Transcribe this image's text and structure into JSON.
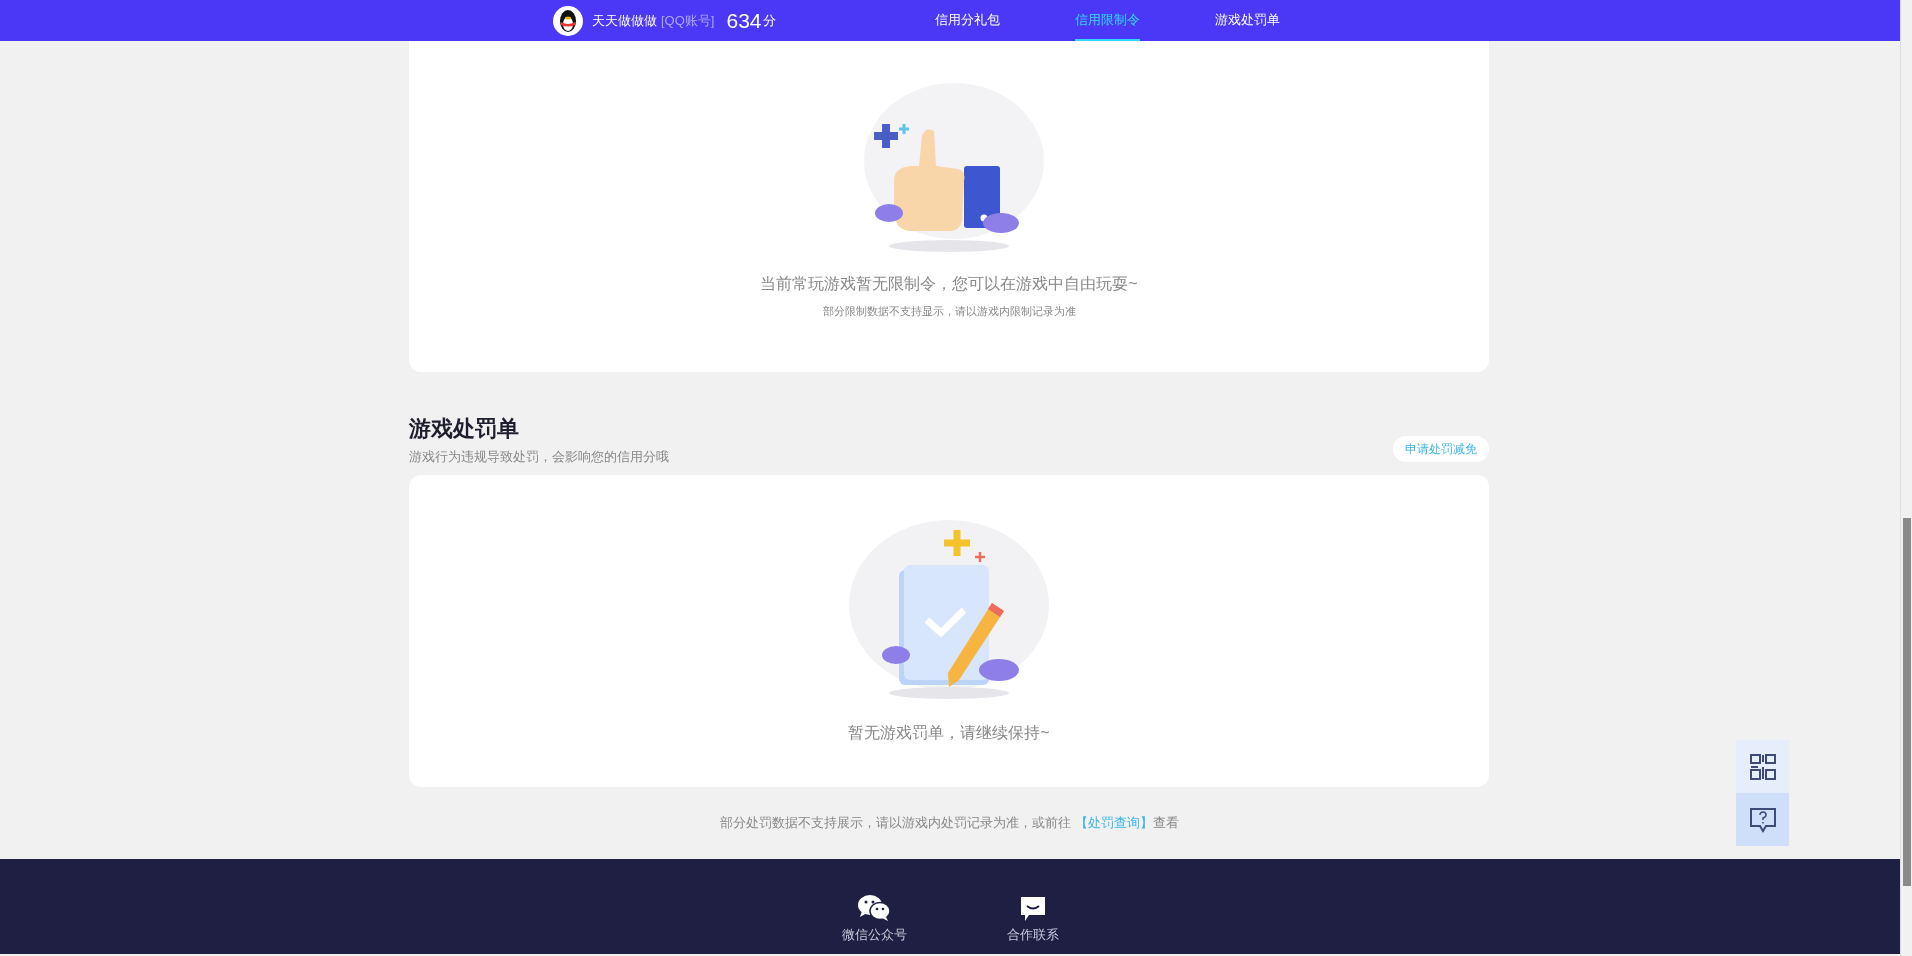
{
  "header": {
    "user_name": "天天做做做",
    "account_type": "[QQ账号]",
    "score": "634",
    "score_unit": "分",
    "tabs": [
      {
        "label": "信用分礼包",
        "selected": false
      },
      {
        "label": "信用限制令",
        "selected": true
      },
      {
        "label": "游戏处罚单",
        "selected": false
      }
    ]
  },
  "restriction_card": {
    "message": "当前常玩游戏暂无限制令，您可以在游戏中自由玩耍~",
    "note": "部分限制数据不支持显示，请以游戏内限制记录为准"
  },
  "penalty_section": {
    "title": "游戏处罚单",
    "subtitle": "游戏行为违规导致处罚，会影响您的信用分哦",
    "action": "申请处罚减免",
    "message": "暂无游戏罚单，请继续保持~"
  },
  "footer_note": {
    "text_before": "部分处罚数据不支持展示，请以游戏内处罚记录为准，或前往",
    "link": "【处罚查询】",
    "text_after": "查看"
  },
  "footer": {
    "links": [
      {
        "label": "微信公众号",
        "kind": "wechat"
      },
      {
        "label": "合作联系",
        "kind": "contact"
      }
    ]
  },
  "side_tools": [
    {
      "kind": "qrcode",
      "selected": false
    },
    {
      "kind": "help",
      "selected": true
    }
  ]
}
